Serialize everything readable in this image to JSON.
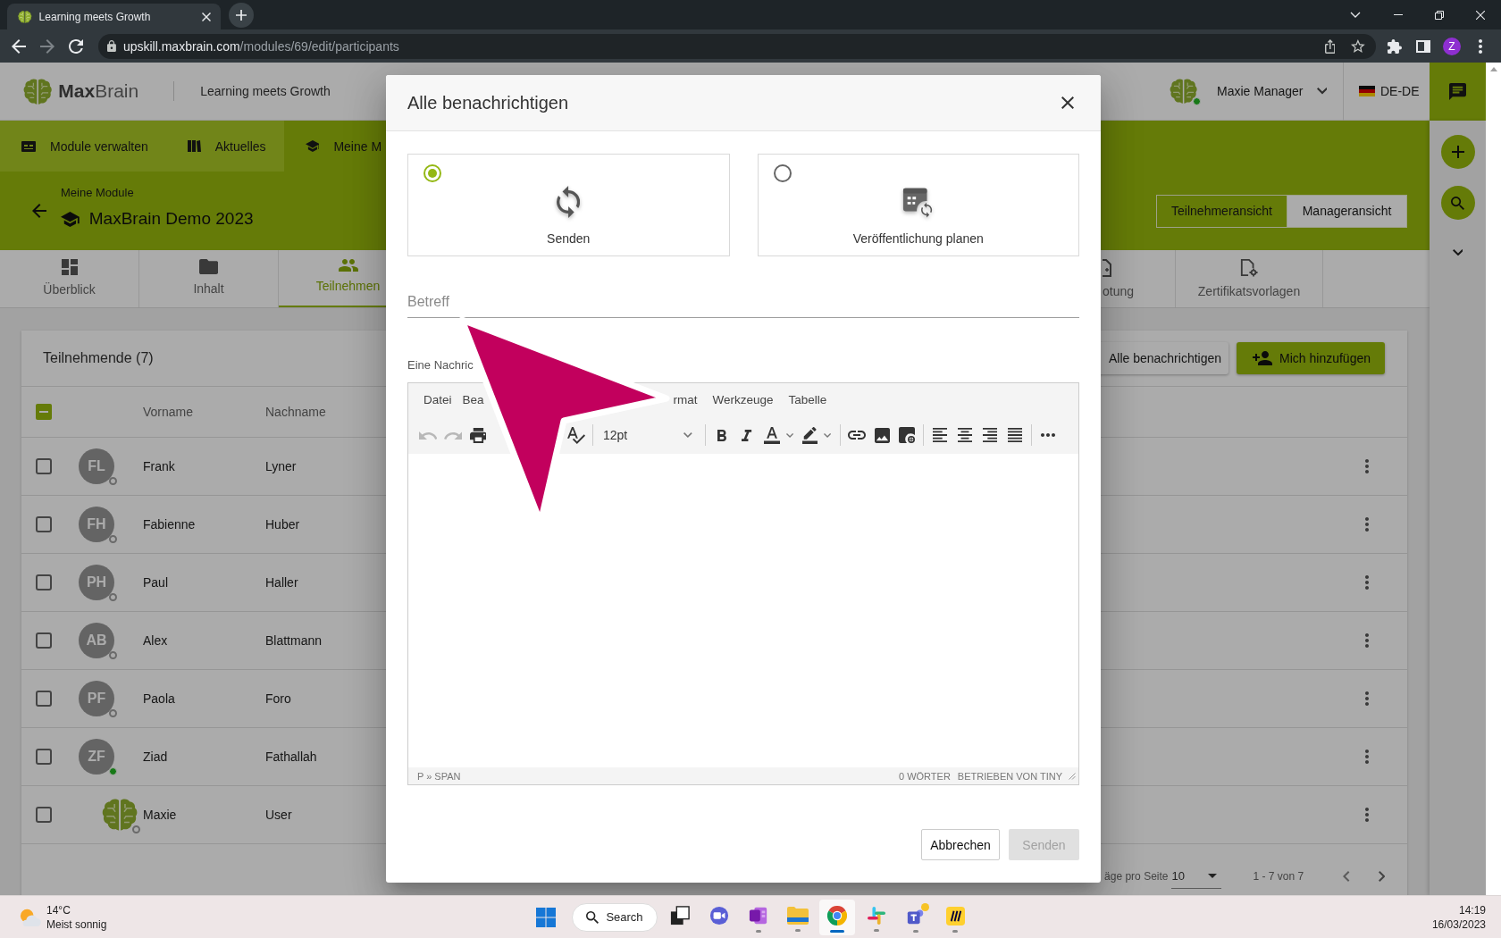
{
  "browser": {
    "tab_title": "Learning meets Growth",
    "url_host": "upskill.maxbrain.com",
    "url_path": "/modules/69/edit/participants",
    "can_go_forward": false,
    "profile_initial": "Z"
  },
  "header": {
    "logo": "**Max**Brain",
    "tagline": "Learning meets Growth",
    "user_name": "Maxie Manager",
    "user_online": true,
    "language": "DE-DE"
  },
  "nav": [
    {
      "label": "Module verwalten",
      "kind": "modules",
      "selected": false
    },
    {
      "label": "Aktuelles",
      "kind": "news",
      "selected": false
    },
    {
      "label": "Meine M",
      "kind": "school",
      "selected": true
    }
  ],
  "module": {
    "breadcrumb": "Meine Module",
    "title": "MaxBrain Demo 2023"
  },
  "view_toggle": [
    {
      "label": "Teilnehmeransicht",
      "selected": false
    },
    {
      "label": "Manageransicht",
      "selected": true
    }
  ],
  "tabs": [
    {
      "label": "Überblick",
      "kind": "dashboard",
      "selected": false
    },
    {
      "label": "Inhalt",
      "kind": "folder",
      "selected": false
    },
    {
      "label": "Teilnehmen",
      "kind": "people",
      "selected": true
    },
    {
      "label": "otung",
      "kind": "document",
      "selected": false
    },
    {
      "label": "Zertifikatsvorlagen",
      "kind": "certificate",
      "selected": false
    }
  ],
  "participants": {
    "title": "Teilnehmende (7)",
    "actions": [
      {
        "label": "Alle benachrichtigen",
        "kind": "secondary"
      },
      {
        "label": "Mich hinzufügen",
        "kind": "primary"
      }
    ],
    "select_all": {
      "checked": false,
      "indeterminate": true
    },
    "columns": [
      "Vorname",
      "Nachname"
    ],
    "rows": [
      {
        "kind": "initials",
        "initials": "FL",
        "first_name": "Frank",
        "last_name": "Lyner",
        "online": false,
        "checked": false
      },
      {
        "kind": "initials",
        "initials": "FH",
        "first_name": "Fabienne",
        "last_name": "Huber",
        "online": false,
        "checked": false
      },
      {
        "kind": "initials",
        "initials": "PH",
        "first_name": "Paul",
        "last_name": "Haller",
        "online": false,
        "checked": false
      },
      {
        "kind": "initials",
        "initials": "AB",
        "first_name": "Alex",
        "last_name": "Blattmann",
        "online": false,
        "checked": false
      },
      {
        "kind": "initials",
        "initials": "PF",
        "first_name": "Paola",
        "last_name": "Foro",
        "online": false,
        "checked": false
      },
      {
        "kind": "initials",
        "initials": "ZF",
        "first_name": "Ziad",
        "last_name": "Fathallah",
        "online": true,
        "checked": false
      },
      {
        "kind": "logo",
        "first_name": "Maxie",
        "last_name": "User",
        "online": false,
        "checked": false
      }
    ],
    "pagination": {
      "per_page_label": "äge pro Seite",
      "per_page": "10",
      "range": "1 - 7 von 7"
    }
  },
  "dialog": {
    "title": "Alle benachrichtigen",
    "options": [
      {
        "label": "Senden",
        "kind": "sync",
        "selected": true
      },
      {
        "label": "Veröffentlichung planen",
        "kind": "schedule",
        "selected": false
      }
    ],
    "subject": {
      "placeholder": "Betreff"
    },
    "message_label": "Eine Nachric",
    "editor": {
      "menu": [
        [
          "Datei",
          "Bea"
        ],
        [
          "rmat",
          "Werkzeuge",
          "Tabelle"
        ]
      ],
      "toolbar": [
        [
          {
            "kind": "undo",
            "disabled": true
          },
          {
            "kind": "redo",
            "disabled": true
          },
          {
            "kind": "print",
            "disabled": false
          }
        ],
        [
          {
            "kind": "spellcheck",
            "disabled": false
          }
        ],
        [
          {
            "kind": "font-size",
            "value": "12pt",
            "disabled": false
          }
        ],
        [
          {
            "kind": "bold",
            "disabled": false
          },
          {
            "kind": "italic",
            "disabled": false
          },
          {
            "kind": "text-color",
            "disabled": false
          },
          {
            "kind": "highlight",
            "disabled": false
          }
        ],
        [
          {
            "kind": "link",
            "disabled": false
          },
          {
            "kind": "image",
            "disabled": false
          },
          {
            "kind": "media",
            "disabled": false
          }
        ],
        [
          {
            "kind": "align-left",
            "disabled": false
          },
          {
            "kind": "align-center",
            "disabled": false
          },
          {
            "kind": "align-right",
            "disabled": false
          },
          {
            "kind": "justify",
            "disabled": false
          }
        ],
        [
          {
            "kind": "more",
            "disabled": false
          }
        ]
      ],
      "path": "P » SPAN",
      "word_count": "0 WÖRTER",
      "branding": "BETRIEBEN VON TINY"
    },
    "buttons": [
      {
        "label": "Abbrechen",
        "kind": "secondary",
        "disabled": false
      },
      {
        "label": "Senden",
        "kind": "primary",
        "disabled": true
      }
    ]
  },
  "taskbar": {
    "weather": {
      "temperature": "14°C",
      "condition": "Meist sonnig"
    },
    "search_label": "Search",
    "apps": [
      {
        "kind": "taskview",
        "running": false,
        "selected": false,
        "badge": false
      },
      {
        "kind": "camera",
        "running": false,
        "selected": false,
        "badge": false
      },
      {
        "kind": "notebook",
        "running": true,
        "selected": false,
        "badge": false
      },
      {
        "kind": "folder",
        "running": true,
        "selected": false,
        "badge": false
      },
      {
        "kind": "browser",
        "running": true,
        "selected": true,
        "badge": false
      },
      {
        "kind": "hash",
        "running": true,
        "selected": false,
        "badge": false
      },
      {
        "kind": "team",
        "running": true,
        "selected": false,
        "badge": true
      },
      {
        "kind": "board",
        "running": true,
        "selected": false,
        "badge": false
      }
    ],
    "time": "14:19",
    "date": "16/03/2023"
  }
}
